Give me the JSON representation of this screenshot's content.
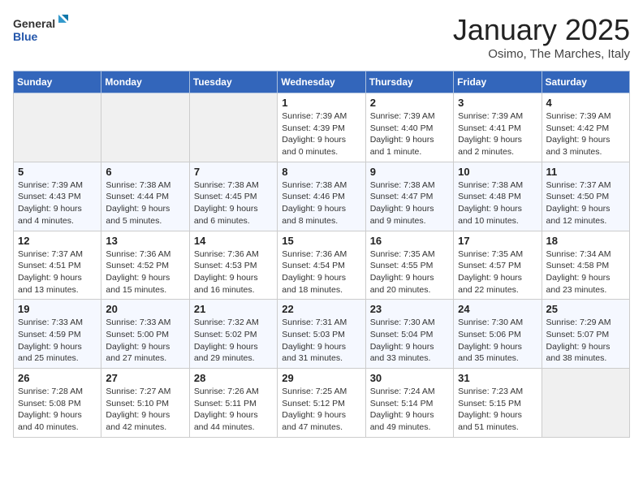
{
  "header": {
    "logo_general": "General",
    "logo_blue": "Blue",
    "title": "January 2025",
    "subtitle": "Osimo, The Marches, Italy"
  },
  "weekdays": [
    "Sunday",
    "Monday",
    "Tuesday",
    "Wednesday",
    "Thursday",
    "Friday",
    "Saturday"
  ],
  "weeks": [
    [
      {
        "day": "",
        "info": ""
      },
      {
        "day": "",
        "info": ""
      },
      {
        "day": "",
        "info": ""
      },
      {
        "day": "1",
        "info": "Sunrise: 7:39 AM\nSunset: 4:39 PM\nDaylight: 9 hours\nand 0 minutes."
      },
      {
        "day": "2",
        "info": "Sunrise: 7:39 AM\nSunset: 4:40 PM\nDaylight: 9 hours\nand 1 minute."
      },
      {
        "day": "3",
        "info": "Sunrise: 7:39 AM\nSunset: 4:41 PM\nDaylight: 9 hours\nand 2 minutes."
      },
      {
        "day": "4",
        "info": "Sunrise: 7:39 AM\nSunset: 4:42 PM\nDaylight: 9 hours\nand 3 minutes."
      }
    ],
    [
      {
        "day": "5",
        "info": "Sunrise: 7:39 AM\nSunset: 4:43 PM\nDaylight: 9 hours\nand 4 minutes."
      },
      {
        "day": "6",
        "info": "Sunrise: 7:38 AM\nSunset: 4:44 PM\nDaylight: 9 hours\nand 5 minutes."
      },
      {
        "day": "7",
        "info": "Sunrise: 7:38 AM\nSunset: 4:45 PM\nDaylight: 9 hours\nand 6 minutes."
      },
      {
        "day": "8",
        "info": "Sunrise: 7:38 AM\nSunset: 4:46 PM\nDaylight: 9 hours\nand 8 minutes."
      },
      {
        "day": "9",
        "info": "Sunrise: 7:38 AM\nSunset: 4:47 PM\nDaylight: 9 hours\nand 9 minutes."
      },
      {
        "day": "10",
        "info": "Sunrise: 7:38 AM\nSunset: 4:48 PM\nDaylight: 9 hours\nand 10 minutes."
      },
      {
        "day": "11",
        "info": "Sunrise: 7:37 AM\nSunset: 4:50 PM\nDaylight: 9 hours\nand 12 minutes."
      }
    ],
    [
      {
        "day": "12",
        "info": "Sunrise: 7:37 AM\nSunset: 4:51 PM\nDaylight: 9 hours\nand 13 minutes."
      },
      {
        "day": "13",
        "info": "Sunrise: 7:36 AM\nSunset: 4:52 PM\nDaylight: 9 hours\nand 15 minutes."
      },
      {
        "day": "14",
        "info": "Sunrise: 7:36 AM\nSunset: 4:53 PM\nDaylight: 9 hours\nand 16 minutes."
      },
      {
        "day": "15",
        "info": "Sunrise: 7:36 AM\nSunset: 4:54 PM\nDaylight: 9 hours\nand 18 minutes."
      },
      {
        "day": "16",
        "info": "Sunrise: 7:35 AM\nSunset: 4:55 PM\nDaylight: 9 hours\nand 20 minutes."
      },
      {
        "day": "17",
        "info": "Sunrise: 7:35 AM\nSunset: 4:57 PM\nDaylight: 9 hours\nand 22 minutes."
      },
      {
        "day": "18",
        "info": "Sunrise: 7:34 AM\nSunset: 4:58 PM\nDaylight: 9 hours\nand 23 minutes."
      }
    ],
    [
      {
        "day": "19",
        "info": "Sunrise: 7:33 AM\nSunset: 4:59 PM\nDaylight: 9 hours\nand 25 minutes."
      },
      {
        "day": "20",
        "info": "Sunrise: 7:33 AM\nSunset: 5:00 PM\nDaylight: 9 hours\nand 27 minutes."
      },
      {
        "day": "21",
        "info": "Sunrise: 7:32 AM\nSunset: 5:02 PM\nDaylight: 9 hours\nand 29 minutes."
      },
      {
        "day": "22",
        "info": "Sunrise: 7:31 AM\nSunset: 5:03 PM\nDaylight: 9 hours\nand 31 minutes."
      },
      {
        "day": "23",
        "info": "Sunrise: 7:30 AM\nSunset: 5:04 PM\nDaylight: 9 hours\nand 33 minutes."
      },
      {
        "day": "24",
        "info": "Sunrise: 7:30 AM\nSunset: 5:06 PM\nDaylight: 9 hours\nand 35 minutes."
      },
      {
        "day": "25",
        "info": "Sunrise: 7:29 AM\nSunset: 5:07 PM\nDaylight: 9 hours\nand 38 minutes."
      }
    ],
    [
      {
        "day": "26",
        "info": "Sunrise: 7:28 AM\nSunset: 5:08 PM\nDaylight: 9 hours\nand 40 minutes."
      },
      {
        "day": "27",
        "info": "Sunrise: 7:27 AM\nSunset: 5:10 PM\nDaylight: 9 hours\nand 42 minutes."
      },
      {
        "day": "28",
        "info": "Sunrise: 7:26 AM\nSunset: 5:11 PM\nDaylight: 9 hours\nand 44 minutes."
      },
      {
        "day": "29",
        "info": "Sunrise: 7:25 AM\nSunset: 5:12 PM\nDaylight: 9 hours\nand 47 minutes."
      },
      {
        "day": "30",
        "info": "Sunrise: 7:24 AM\nSunset: 5:14 PM\nDaylight: 9 hours\nand 49 minutes."
      },
      {
        "day": "31",
        "info": "Sunrise: 7:23 AM\nSunset: 5:15 PM\nDaylight: 9 hours\nand 51 minutes."
      },
      {
        "day": "",
        "info": ""
      }
    ]
  ]
}
